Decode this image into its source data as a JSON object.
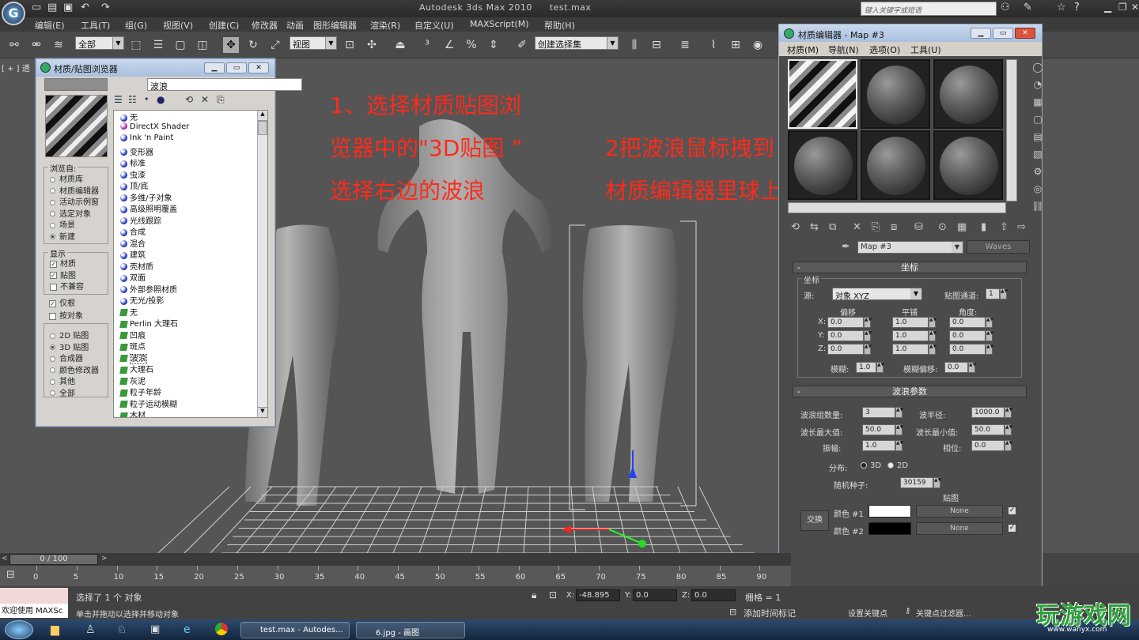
{
  "window": {
    "app_title": "Autodesk 3ds Max  2010",
    "file_name": "test.max",
    "search_placeholder": "键入关键字或短语"
  },
  "menubar": [
    "编辑(E)",
    "工具(T)",
    "组(G)",
    "视图(V)",
    "创建(C)",
    "修改器",
    "动画",
    "图形编辑器",
    "渲染(R)",
    "自定义(U)",
    "MAXScript(M)",
    "帮助(H)"
  ],
  "toolbar": {
    "selection_filter": "全部",
    "ref_coord": "视图",
    "named_selection": "创建选择集"
  },
  "viewport": {
    "label": "[ + ] 透"
  },
  "annotations": {
    "step1_line1": "1、选择材质贴图浏",
    "step1_line2": "览器中的\"3D贴图 ”",
    "step1_line3": "选择右边的波浪",
    "step2_line1": "2把波浪鼠标拽到",
    "step2_line2": "材质编辑器里球上"
  },
  "browser": {
    "title": "材质/贴图浏览器",
    "search_value": "波浪",
    "browse_from_label": "浏览自:",
    "browse_from": [
      {
        "label": "材质库",
        "on": false
      },
      {
        "label": "材质编辑器",
        "on": false
      },
      {
        "label": "活动示例窗",
        "on": false
      },
      {
        "label": "选定对象",
        "on": false
      },
      {
        "label": "场景",
        "on": false
      },
      {
        "label": "新建",
        "on": true
      }
    ],
    "show_label": "显示",
    "show": [
      {
        "label": "材质",
        "checked": true
      },
      {
        "label": "贴图",
        "checked": true
      },
      {
        "label": "不兼容",
        "checked": false
      }
    ],
    "root_only": {
      "label": "仅根",
      "checked": true
    },
    "by_object": {
      "label": "按对象",
      "checked": false
    },
    "map_types": [
      {
        "label": "2D 贴图",
        "on": false
      },
      {
        "label": "3D 贴图",
        "on": true
      },
      {
        "label": "合成器",
        "on": false
      },
      {
        "label": "颜色修改器",
        "on": false
      },
      {
        "label": "其他",
        "on": false
      },
      {
        "label": "全部",
        "on": false
      }
    ],
    "items": [
      {
        "label": "无",
        "kind": "mat",
        "color": "#2233bb"
      },
      {
        "label": "DirectX Shader",
        "kind": "mat",
        "color": "#aa22aa"
      },
      {
        "label": "Ink 'n Paint",
        "kind": "mat",
        "color": "#2233bb"
      },
      {
        "label": "变形器",
        "kind": "mat",
        "color": "#2233bb"
      },
      {
        "label": "标准",
        "kind": "mat",
        "color": "#2233bb"
      },
      {
        "label": "虫漆",
        "kind": "mat",
        "color": "#2233bb"
      },
      {
        "label": "顶/底",
        "kind": "mat",
        "color": "#2233bb"
      },
      {
        "label": "多维/子对象",
        "kind": "mat",
        "color": "#2233bb"
      },
      {
        "label": "高级照明覆盖",
        "kind": "mat",
        "color": "#2233bb"
      },
      {
        "label": "光线跟踪",
        "kind": "mat",
        "color": "#2233bb"
      },
      {
        "label": "合成",
        "kind": "mat",
        "color": "#2233bb"
      },
      {
        "label": "混合",
        "kind": "mat",
        "color": "#2233bb"
      },
      {
        "label": "建筑",
        "kind": "mat",
        "color": "#2233bb"
      },
      {
        "label": "壳材质",
        "kind": "mat",
        "color": "#2233bb"
      },
      {
        "label": "双面",
        "kind": "mat",
        "color": "#2233bb"
      },
      {
        "label": "外部参照材质",
        "kind": "mat",
        "color": "#2233bb"
      },
      {
        "label": "无光/投影",
        "kind": "mat",
        "color": "#2233bb"
      },
      {
        "label": "无",
        "kind": "map",
        "color": "#3a9a3a"
      },
      {
        "label": "Perlin 大理石",
        "kind": "map",
        "color": "#3a9a3a"
      },
      {
        "label": "凹痕",
        "kind": "map",
        "color": "#3a9a3a"
      },
      {
        "label": "斑点",
        "kind": "map",
        "color": "#3a9a3a"
      },
      {
        "label": "波浪",
        "kind": "map",
        "color": "#3a9a3a",
        "selected": true
      },
      {
        "label": "大理石",
        "kind": "map",
        "color": "#3a9a3a"
      },
      {
        "label": "灰泥",
        "kind": "map",
        "color": "#3a9a3a"
      },
      {
        "label": "粒子年龄",
        "kind": "map",
        "color": "#3a9a3a"
      },
      {
        "label": "粒子运动模糊",
        "kind": "map",
        "color": "#3a9a3a"
      },
      {
        "label": "木材",
        "kind": "map",
        "color": "#3a9a3a"
      }
    ]
  },
  "mat_editor": {
    "title": "材质编辑器 - Map #3",
    "menu": [
      "材质(M)",
      "导航(N)",
      "选项(O)",
      "工具(U)"
    ],
    "map_name": "Map #3",
    "map_type": "Waves",
    "coords": {
      "header": "坐标",
      "group": "坐标",
      "source_label": "源:",
      "source_value": "对象 XYZ",
      "channel_label": "贴图通道:",
      "channel_value": "1",
      "offset_label": "偏移",
      "tiling_label": "平铺",
      "angle_label": "角度:",
      "rows": [
        {
          "axis": "X:",
          "offset": "0.0",
          "tiling": "1.0",
          "angle": "0.0"
        },
        {
          "axis": "Y:",
          "offset": "0.0",
          "tiling": "1.0",
          "angle": "0.0"
        },
        {
          "axis": "Z:",
          "offset": "0.0",
          "tiling": "1.0",
          "angle": "0.0"
        }
      ],
      "blur_label": "模糊:",
      "blur_value": "1.0",
      "blur_offset_label": "模糊偏移:",
      "blur_offset_value": "0.0"
    },
    "waves": {
      "header": "波浪参数",
      "num_sets_label": "波浪组数量:",
      "num_sets": "3",
      "radius_label": "波半径:",
      "radius": "1000.0",
      "len_max_label": "波长最大值:",
      "len_max": "50.0",
      "len_min_label": "波长最小值:",
      "len_min": "50.0",
      "amp_label": "振幅:",
      "amp": "1.0",
      "phase_label": "相位:",
      "phase": "0.0",
      "dist_label": "分布:",
      "dist_3d": "3D",
      "dist_2d": "2D",
      "seed_label": "随机种子:",
      "seed": "30159",
      "maps_label": "贴图",
      "swap_label": "交换",
      "color1_label": "颜色 #1",
      "color2_label": "颜色 #2",
      "none1": "None",
      "none2": "None"
    }
  },
  "timeline": {
    "frame": "0 / 100",
    "ticks": [
      "0",
      "5",
      "10",
      "15",
      "20",
      "25",
      "30",
      "35",
      "40",
      "45",
      "50",
      "55",
      "60",
      "65",
      "70",
      "75",
      "80",
      "85",
      "90"
    ]
  },
  "statusbar": {
    "maxscript": "欢迎使用 MAXSc",
    "status1": "选择了 1 个 对象",
    "status2": "单击并拖动以选择并移动对象",
    "x_label": "X:",
    "x_value": "-48.895",
    "y_label": "Y:",
    "y_value": "0.0",
    "z_label": "Z:",
    "z_value": "0.0",
    "grid_label": "栅格 = 1",
    "add_time_tag": "添加时间标记",
    "set_key": "设置关键点",
    "key_filter": "关键点过滤器..."
  },
  "taskbar": {
    "task1": "test.max - Autodes...",
    "task2": "6.jpg - 画图"
  },
  "watermark": {
    "brand": "玩游戏网",
    "url": "www.wanyx.com"
  }
}
